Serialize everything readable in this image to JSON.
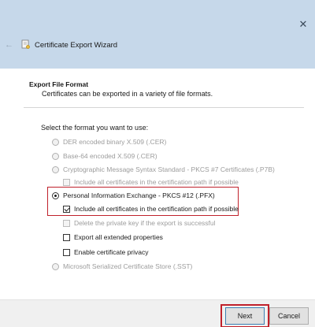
{
  "window": {
    "title": "Certificate Export Wizard",
    "close_glyph": "✕",
    "back_glyph": "←"
  },
  "header": {
    "section_title": "Export File Format",
    "section_desc": "Certificates can be exported in a variety of file formats."
  },
  "body": {
    "prompt": "Select the format you want to use:",
    "options": [
      {
        "type": "radio",
        "label": "DER encoded binary X.509 (.CER)",
        "checked": false,
        "enabled": false
      },
      {
        "type": "radio",
        "label": "Base-64 encoded X.509 (.CER)",
        "checked": false,
        "enabled": false
      },
      {
        "type": "radio",
        "label": "Cryptographic Message Syntax Standard - PKCS #7 Certificates (.P7B)",
        "checked": false,
        "enabled": false
      },
      {
        "type": "checkbox",
        "label": "Include all certificates in the certification path if possible",
        "checked": false,
        "enabled": false
      },
      {
        "type": "radio",
        "label": "Personal Information Exchange - PKCS #12 (.PFX)",
        "checked": true,
        "enabled": true
      },
      {
        "type": "checkbox",
        "label": "Include all certificates in the certification path if possible",
        "checked": true,
        "enabled": true
      },
      {
        "type": "checkbox",
        "label": "Delete the private key if the export is successful",
        "checked": false,
        "enabled": false
      },
      {
        "type": "checkbox",
        "label": "Export all extended properties",
        "checked": false,
        "enabled": true
      },
      {
        "type": "checkbox",
        "label": "Enable certificate privacy",
        "checked": false,
        "enabled": true
      },
      {
        "type": "radio",
        "label": "Microsoft Serialized Certificate Store (.SST)",
        "checked": false,
        "enabled": false
      }
    ]
  },
  "footer": {
    "next_label": "Next",
    "cancel_label": "Cancel"
  },
  "colors": {
    "titlebar": "#c6d8ea",
    "highlight": "#c0212b"
  }
}
